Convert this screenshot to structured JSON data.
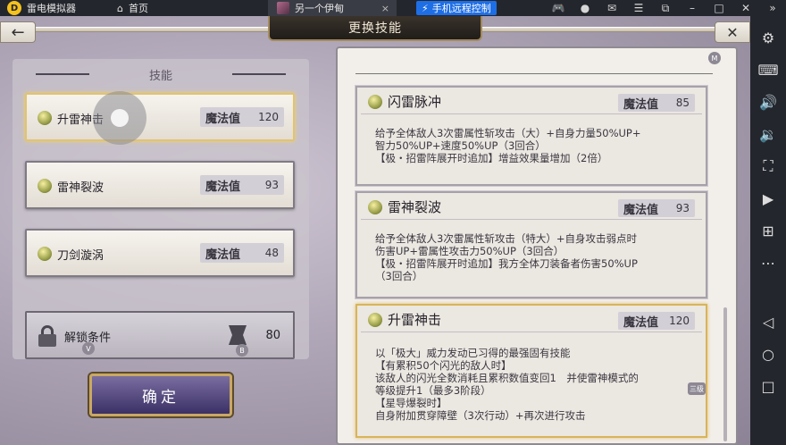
{
  "emulator": {
    "app_name": "雷电模拟器",
    "home_label": "首页",
    "tab_title": "另一个伊甸",
    "remote_label": "手机远程控制"
  },
  "game": {
    "screen_title": "更换技能",
    "left_header": "技能",
    "skills_list": [
      {
        "name": "升雷神击",
        "mp_label": "魔法值",
        "mp": "120"
      },
      {
        "name": "雷神裂波",
        "mp_label": "魔法值",
        "mp": "93"
      },
      {
        "name": "刀剑漩涡",
        "mp_label": "魔法值",
        "mp": "48"
      }
    ],
    "unlock": {
      "label": "解锁条件",
      "count": "80"
    },
    "hints": {
      "v": "V",
      "b": "B",
      "m": "M",
      "scroll": "三级"
    },
    "confirm_label": "确定",
    "details": [
      {
        "name": "闪雷脉冲",
        "mp_label": "魔法值",
        "mp": "85",
        "desc": "给予全体敌人3次雷属性斩攻击（大）+自身力量50%UP+\n智力50%UP+速度50%UP（3回合）\n【极・招雷阵展开时追加】增益效果量增加（2倍）"
      },
      {
        "name": "雷神裂波",
        "mp_label": "魔法值",
        "mp": "93",
        "desc": "给予全体敌人3次雷属性斩攻击（特大）+自身攻击弱点时\n伤害UP+雷属性攻击力50%UP（3回合）\n【极・招雷阵展开时追加】我方全体刀装备者伤害50%UP\n（3回合）"
      },
      {
        "name": "升雷神击",
        "mp_label": "魔法值",
        "mp": "120",
        "desc": "以「极大」威力发动已习得的最强固有技能\n【有累积50个闪光的敌人时】\n该敌人的闪光全数消耗且累积数值变回1　并使雷神模式的\n等级提升1（最多3阶段）\n【星导爆裂时】\n自身附加贯穿障壁（3次行动）+再次进行攻击"
      }
    ]
  }
}
